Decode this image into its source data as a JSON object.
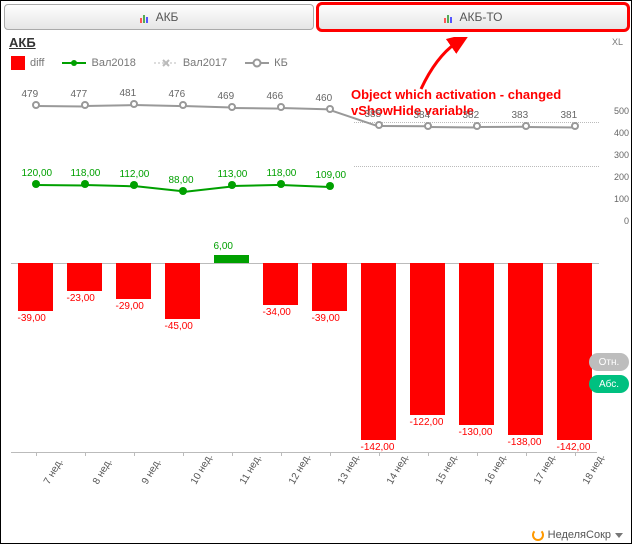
{
  "tabs": {
    "left": "АКБ",
    "right": "АКБ-ТО"
  },
  "title": "АКБ",
  "xl": "XL",
  "legend": {
    "diff": "diff",
    "val2018": "Вал2018",
    "val2017": "Вал2017",
    "kb": "КБ"
  },
  "annotation": {
    "line1": "Object which activation - changed",
    "line2": "vShowHide variable"
  },
  "buttons": {
    "rel": "Отн.",
    "abs": "Абс."
  },
  "footer": "НеделяСокр",
  "chart_data": {
    "categories": [
      "7 нед.",
      "8 нед.",
      "9 нед.",
      "10 нед.",
      "11 нед.",
      "12 нед.",
      "13 нед.",
      "14 нед.",
      "15 нед.",
      "16 нед.",
      "17 нед.",
      "18 нед."
    ],
    "top": {
      "type": "line",
      "ylim": [
        0,
        500
      ],
      "yticks": [
        0,
        100,
        200,
        300,
        400,
        500
      ],
      "series": [
        {
          "name": "КБ",
          "values": [
            479,
            477,
            481,
            476,
            469,
            466,
            460,
            385,
            384,
            382,
            383,
            381
          ]
        },
        {
          "name": "Вал2018",
          "values": [
            120.0,
            118.0,
            112.0,
            88.0,
            113.0,
            118.0,
            109.0,
            null,
            null,
            null,
            null,
            null
          ]
        }
      ]
    },
    "bottom": {
      "type": "bar",
      "name": "diff",
      "values": [
        -39.0,
        -23.0,
        -29.0,
        -45.0,
        6.0,
        -34.0,
        -39.0,
        -142.0,
        -122.0,
        -130.0,
        -138.0,
        -142.0
      ],
      "ylim": [
        -150,
        10
      ]
    }
  }
}
